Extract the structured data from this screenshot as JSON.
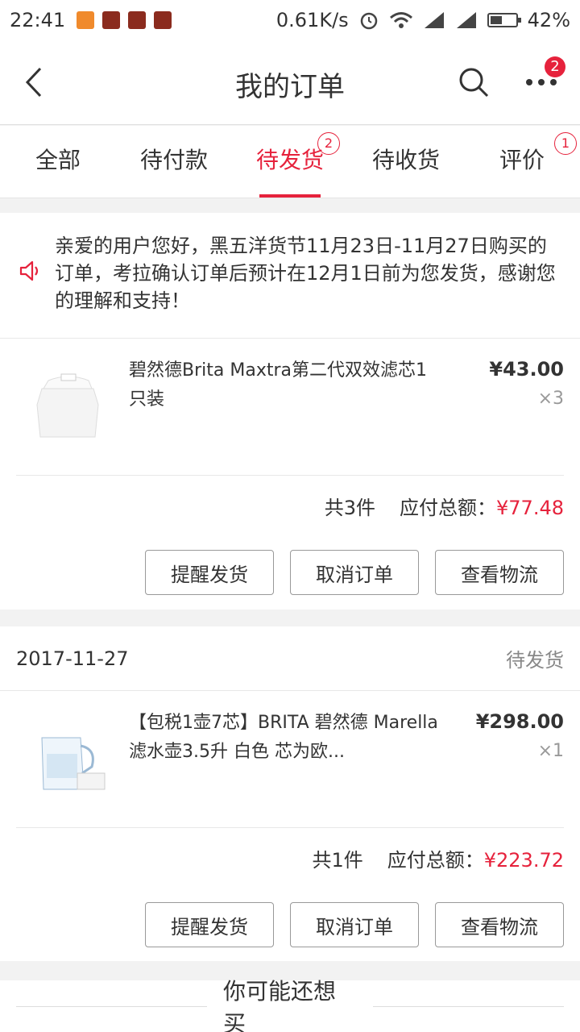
{
  "status_bar": {
    "time": "22:41",
    "network_speed": "0.61K/s",
    "battery": "42%"
  },
  "nav": {
    "title": "我的订单",
    "more_badge": "2"
  },
  "tabs": [
    {
      "label": "全部",
      "badge": ""
    },
    {
      "label": "待付款",
      "badge": ""
    },
    {
      "label": "待发货",
      "badge": "2",
      "active": true
    },
    {
      "label": "待收货",
      "badge": ""
    },
    {
      "label": "评价",
      "badge": "1"
    }
  ],
  "orders": [
    {
      "notice": "亲爱的用户您好，黑五洋货节11月23日-11月27日购买的订单，考拉确认订单后预计在12月1日前为您发货，感谢您的理解和支持！",
      "product": {
        "name": "碧然德Brita Maxtra第二代双效滤芯1只装",
        "price": "¥43.00",
        "qty": "×3"
      },
      "count": "共3件",
      "total_label": "应付总额：",
      "total": "¥77.48",
      "buttons": [
        "提醒发货",
        "取消订单",
        "查看物流"
      ]
    },
    {
      "date": "2017-11-27",
      "status": "待发货",
      "product": {
        "name": "【包税1壶7芯】BRITA 碧然德 Marella滤水壶3.5升 白色 芯为欧...",
        "price": "¥298.00",
        "qty": "×1"
      },
      "count": "共1件",
      "total_label": "应付总额：",
      "total": "¥223.72",
      "buttons": [
        "提醒发货",
        "取消订单",
        "查看物流"
      ]
    }
  ],
  "suggest": {
    "label": "你可能还想买"
  },
  "colors": {
    "accent": "#e6223c"
  }
}
